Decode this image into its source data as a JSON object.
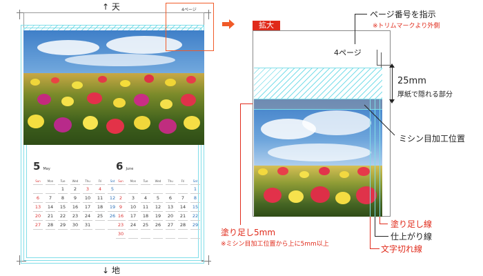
{
  "left_page": {
    "top_mark": "↑ 天",
    "bottom_mark": "↓ 地",
    "page_number": "4ページ",
    "months": [
      {
        "number": "5",
        "name": "May",
        "weekdays": [
          "Sun",
          "Mon",
          "Tue",
          "Wed",
          "Thu",
          "Fri",
          "Sat"
        ],
        "rows": [
          [
            "",
            "",
            "1",
            "2",
            "3",
            "4",
            "5"
          ],
          [
            "6",
            "7",
            "8",
            "9",
            "10",
            "11",
            "12"
          ],
          [
            "13",
            "14",
            "15",
            "16",
            "17",
            "18",
            "19"
          ],
          [
            "20",
            "21",
            "22",
            "23",
            "24",
            "25",
            "26"
          ],
          [
            "27",
            "28",
            "29",
            "30",
            "31",
            "",
            ""
          ]
        ]
      },
      {
        "number": "6",
        "name": "June",
        "weekdays": [
          "Sun",
          "Mon",
          "Tue",
          "Wed",
          "Thu",
          "Fri",
          "Sat"
        ],
        "rows": [
          [
            "",
            "",
            "",
            "",
            "",
            "",
            "1"
          ],
          [
            "2",
            "3",
            "4",
            "5",
            "6",
            "7",
            "8"
          ],
          [
            "9",
            "10",
            "11",
            "12",
            "13",
            "14",
            "15"
          ],
          [
            "16",
            "17",
            "18",
            "19",
            "20",
            "21",
            "22"
          ],
          [
            "23",
            "24",
            "25",
            "26",
            "27",
            "28",
            "29"
          ],
          [
            "30",
            "",
            "",
            "",
            "",
            "",
            ""
          ]
        ]
      }
    ]
  },
  "zoom": {
    "badge": "拡大",
    "page_number": "4ページ"
  },
  "callouts": {
    "page_number_title": "ページ番号を指示",
    "page_number_note": "※トリムマークより外側",
    "measure_value": "25mm",
    "measure_note": "厚紙で隠れる部分",
    "perforation": "ミシン目加工位置",
    "bleed_title": "塗り足し5mm",
    "bleed_note": "※ミシン目加工位置から上に5mm以上",
    "bleed_line": "塗り足し線",
    "trim_line": "仕上がり線",
    "text_cut_line": "文字切れ線"
  },
  "colors": {
    "guide_cyan": "#7fdde8",
    "accent_red": "#e02a1a",
    "arrow_orange": "#f05a28"
  }
}
